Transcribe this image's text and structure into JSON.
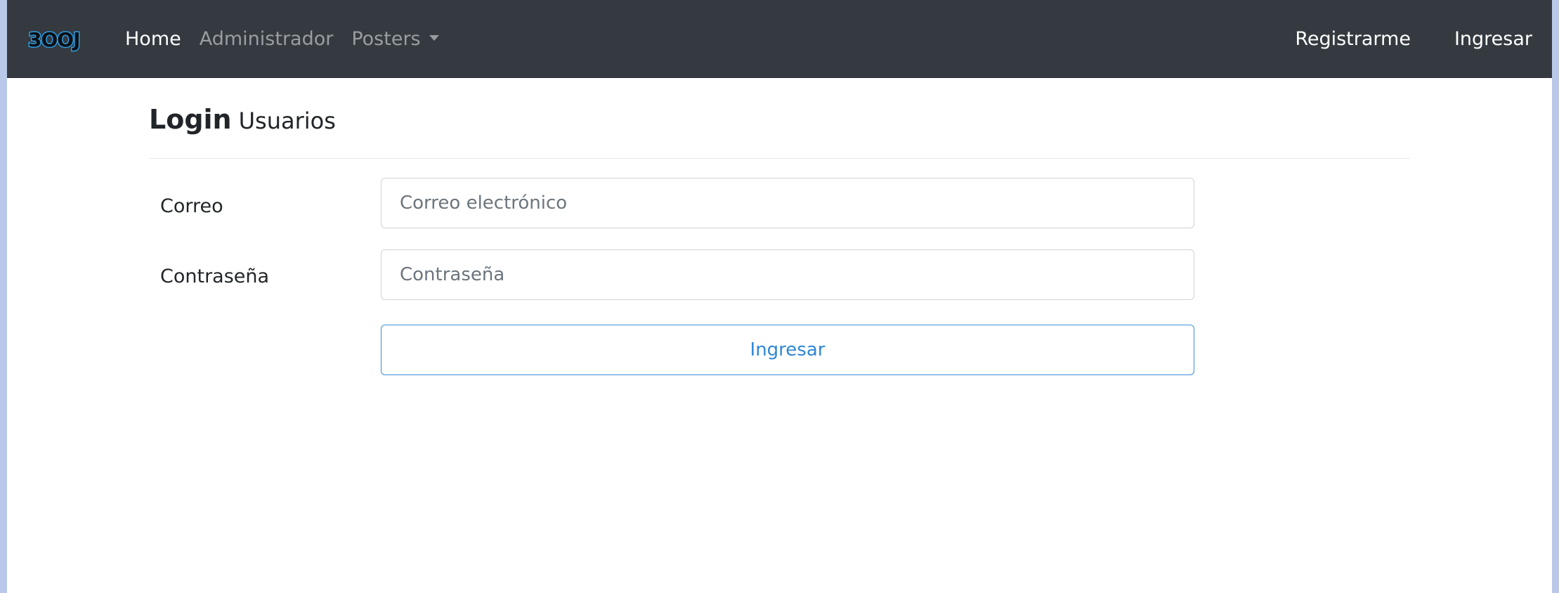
{
  "navbar": {
    "brand": "3OOJ",
    "links": [
      {
        "label": "Home",
        "active": true
      },
      {
        "label": "Administrador",
        "active": false
      },
      {
        "label": "Posters",
        "active": false,
        "dropdown": true
      }
    ],
    "right_links": [
      {
        "label": "Registrarme"
      },
      {
        "label": "Ingresar"
      }
    ],
    "background_color": "#343a40"
  },
  "page": {
    "title_strong": "Login",
    "title_small": "Usuarios"
  },
  "form": {
    "email_label": "Correo",
    "email_placeholder": "Correo electrónico",
    "password_label": "Contraseña",
    "password_placeholder": "Contraseña",
    "submit_label": "Ingresar",
    "accent_color": "#2f87d6"
  }
}
